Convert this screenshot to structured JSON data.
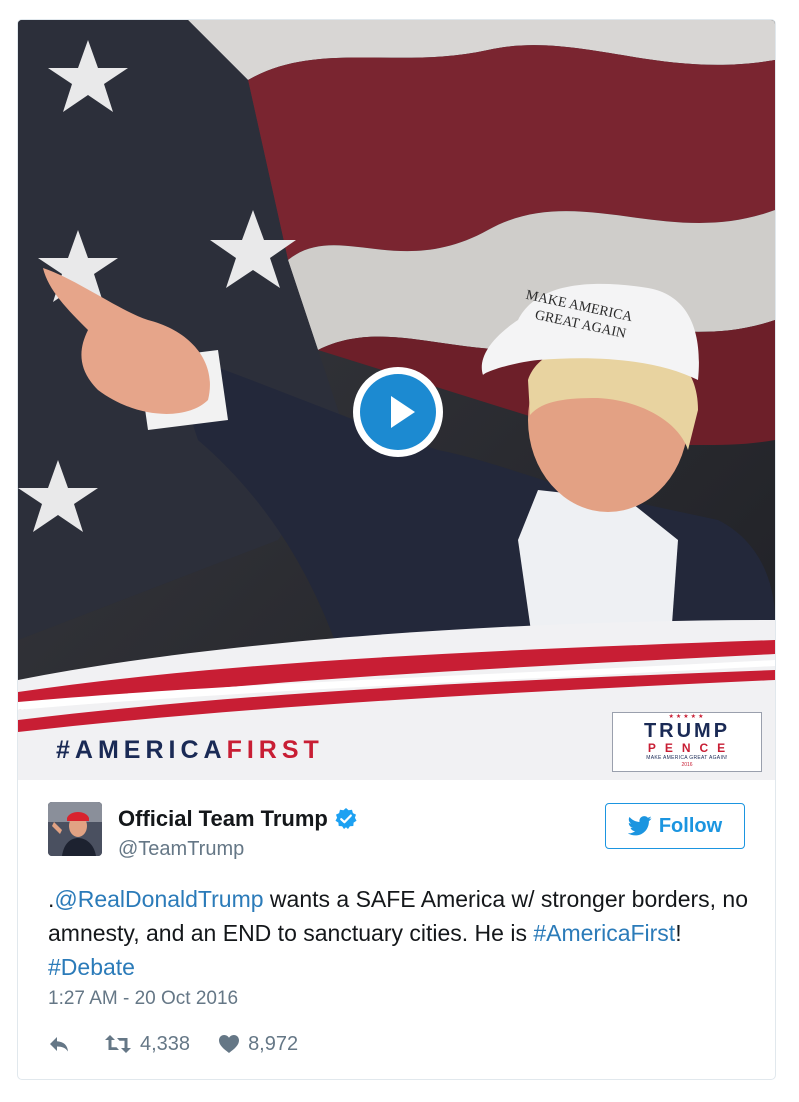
{
  "media": {
    "banner_hashtag_prefix": "#AMERICA",
    "banner_hashtag_suffix": "FIRST",
    "cap_line1": "MAKE AMERICA",
    "cap_line2": "GREAT AGAIN",
    "logo": {
      "stars": "★★★★★",
      "line1": "TRUMP",
      "line2": "PENCE",
      "line3": "MAKE AMERICA GREAT AGAIN!",
      "line4": "2016"
    }
  },
  "author": {
    "name": "Official Team Trump",
    "handle": "@TeamTrump",
    "verified": true
  },
  "follow_label": "Follow",
  "tweet": {
    "prefix": ".",
    "mention": "@RealDonaldTrump",
    "body": " wants a SAFE America w/ stronger borders, no amnesty, and an END to sanctuary cities. He is ",
    "hashtag1": "#AmericaFirst",
    "separator": "! ",
    "hashtag2": "#Debate"
  },
  "timestamp": "1:27 AM - 20 Oct 2016",
  "stats": {
    "retweets": "4,338",
    "likes": "8,972"
  },
  "colors": {
    "link": "#2b7bb9",
    "follow": "#1b95e0",
    "play": "#1c8ad1",
    "banner_navy": "#1a2a55",
    "banner_red": "#c81e34"
  },
  "icons": [
    "play-icon",
    "verified-icon",
    "twitter-bird-icon",
    "reply-icon",
    "retweet-icon",
    "heart-icon"
  ]
}
